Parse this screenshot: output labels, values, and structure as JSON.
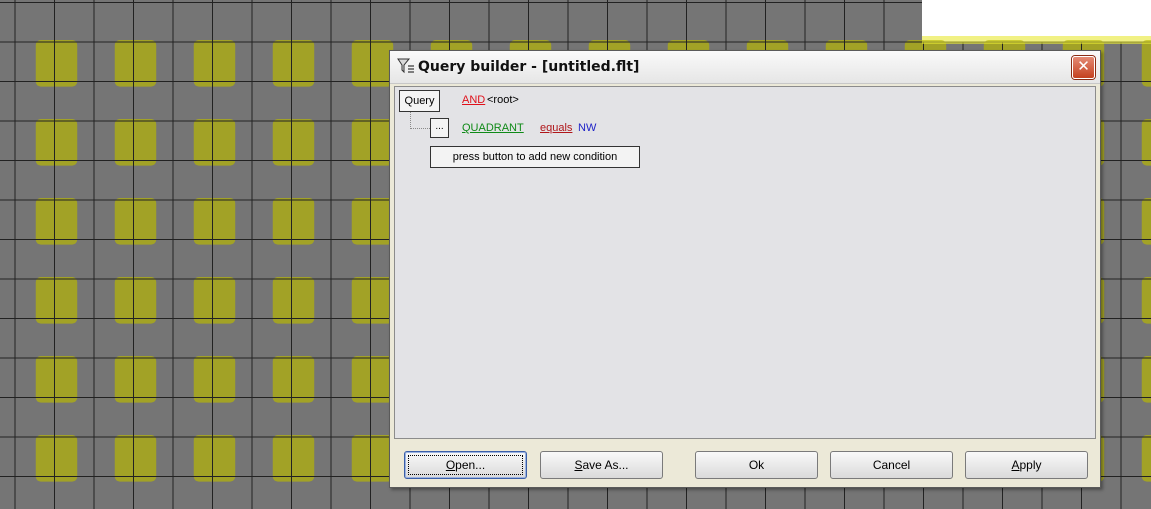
{
  "colors": {
    "grid_bg": "#757575",
    "grid_line": "#222222",
    "tile": "#a4a422",
    "tile_highlight": "#e7e832"
  },
  "dialog": {
    "title": "Query builder - [untitled.flt]",
    "icon": "funnel-filter-icon",
    "close_icon": "close-icon",
    "close_glyph": "✕"
  },
  "query": {
    "root_label": "Query",
    "operator": "AND",
    "root_tag": "<root>",
    "condition": {
      "button_label": "...",
      "field": "QUADRANT",
      "operator": "equals",
      "value": "NW"
    },
    "tooltip": "press button to add new condition"
  },
  "buttons": {
    "open_mnemonic": "O",
    "open_rest": "pen...",
    "save_mnemonic": "S",
    "save_rest": "ave As...",
    "ok": "Ok",
    "cancel": "Cancel",
    "apply_mnemonic": "A",
    "apply_rest": "pply"
  }
}
